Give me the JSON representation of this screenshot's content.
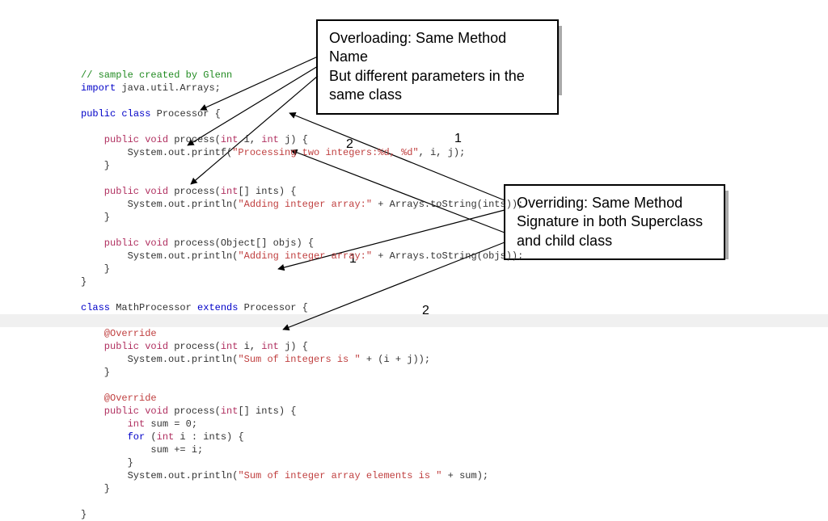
{
  "callouts": {
    "overloading": {
      "line1": "Overloading: Same Method Name",
      "line2": "But different parameters in the",
      "line3": "same class"
    },
    "overriding": {
      "line1": "Overriding: Same Method",
      "line2": "Signature in both Superclass",
      "line3": "and child class"
    }
  },
  "labels": {
    "top_one": "1",
    "top_two": "2",
    "bot_one": "1",
    "bot_two": "2"
  },
  "code": {
    "l01_comment": "// sample created by Glenn",
    "l02_import": "import",
    "l02_rest": " java.util.Arrays;",
    "l04_public": "public",
    "l04_class": " class",
    "l04_name": " Processor {",
    "l06_mod": "    public void",
    "l06_sig": " process(",
    "l06_int1": "int",
    "l06_mid": " i, ",
    "l06_int2": "int",
    "l06_end": " j) {",
    "l07_pre": "        System.out.printf(",
    "l07_str": "\"Processing two integers:%d, %d\"",
    "l07_end": ", i, j);",
    "l08_close": "    }",
    "l10_mod": "    public void",
    "l10_sig": " process(",
    "l10_type": "int",
    "l10_end": "[] ints) {",
    "l11_pre": "        System.out.println(",
    "l11_str": "\"Adding integer array:\"",
    "l11_end": " + Arrays.toString(ints));",
    "l12_close": "    }",
    "l14_mod": "    public void",
    "l14_sig": " process(Object[] objs) {",
    "l15_pre": "        System.out.println(",
    "l15_str": "\"Adding integer array:\"",
    "l15_end": " + Arrays.toString(objs));",
    "l16_close": "    }",
    "l17_close": "}",
    "l19_class": "class",
    "l19_name": " MathProcessor ",
    "l19_ext": "extends",
    "l19_rest": " Processor {",
    "l21_annot": "    @Override",
    "l22_mod": "    public void",
    "l22_sig": " process(",
    "l22_int1": "int",
    "l22_mid": " i, ",
    "l22_int2": "int",
    "l22_end": " j) {",
    "l23_pre": "        System.out.println(",
    "l23_str": "\"Sum of integers is \"",
    "l23_end": " + (i + j));",
    "l24_close": "    }",
    "l26_annot": "    @Override",
    "l27_mod": "    public void",
    "l27_sig": " process(",
    "l27_type": "int",
    "l27_end": "[] ints) {",
    "l28_a": "        int",
    "l28_b": " sum = 0;",
    "l29_a": "        for",
    "l29_b": " (",
    "l29_c": "int",
    "l29_d": " i : ints) {",
    "l30": "            sum += i;",
    "l31": "        }",
    "l32_pre": "        System.out.println(",
    "l32_str": "\"Sum of integer array elements is \"",
    "l32_end": " + sum);",
    "l33_close": "    }",
    "l35_close": "}"
  }
}
